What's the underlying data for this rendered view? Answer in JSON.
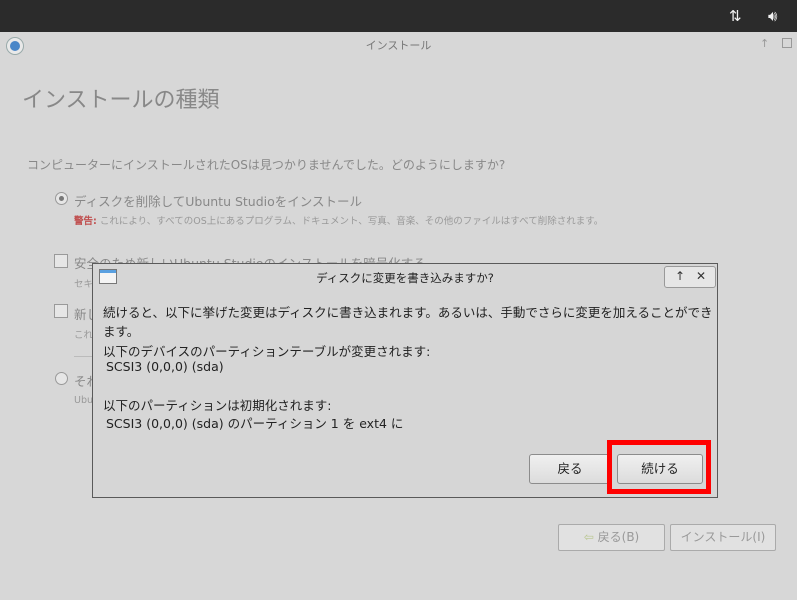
{
  "window": {
    "title": "インストール"
  },
  "page": {
    "title": "インストールの種類",
    "question": "コンピューターにインストールされたOSは見つかりませんでした。どのようにしますか?"
  },
  "options": [
    {
      "label": "ディスクを削除してUbuntu Studioをインストール",
      "warning_label": "警告:",
      "sub": "これにより、すべてのOS上にあるプログラム、ドキュメント、写真、音楽、その他のファイルはすべて削除されます。"
    },
    {
      "label": "安全のため新しいUbuntu Studioのインストールを暗号化する",
      "sub": "セキ"
    },
    {
      "label": "新し",
      "sub": "これ"
    },
    {
      "label": "それ",
      "sub": "Ubu"
    }
  ],
  "nav": {
    "back_label": "戻る(B)",
    "install_label": "インストール(I)"
  },
  "dialog": {
    "title": "ディスクに変更を書き込みますか?",
    "line1": "続けると、以下に挙げた変更はディスクに書き込まれます。あるいは、手動でさらに変更を加えることができます。",
    "devices_heading": "以下のデバイスのパーティションテーブルが変更されます:",
    "device": "SCSI3 (0,0,0) (sda)",
    "partitions_heading": "以下のパーティションは初期化されます:",
    "partition": "SCSI3 (0,0,0) (sda) のパーティション 1 を ext4 に",
    "back_label": "戻る",
    "continue_label": "続ける"
  },
  "colors": {
    "highlight": "#ff0000",
    "topbar": "#2b2b2b"
  }
}
